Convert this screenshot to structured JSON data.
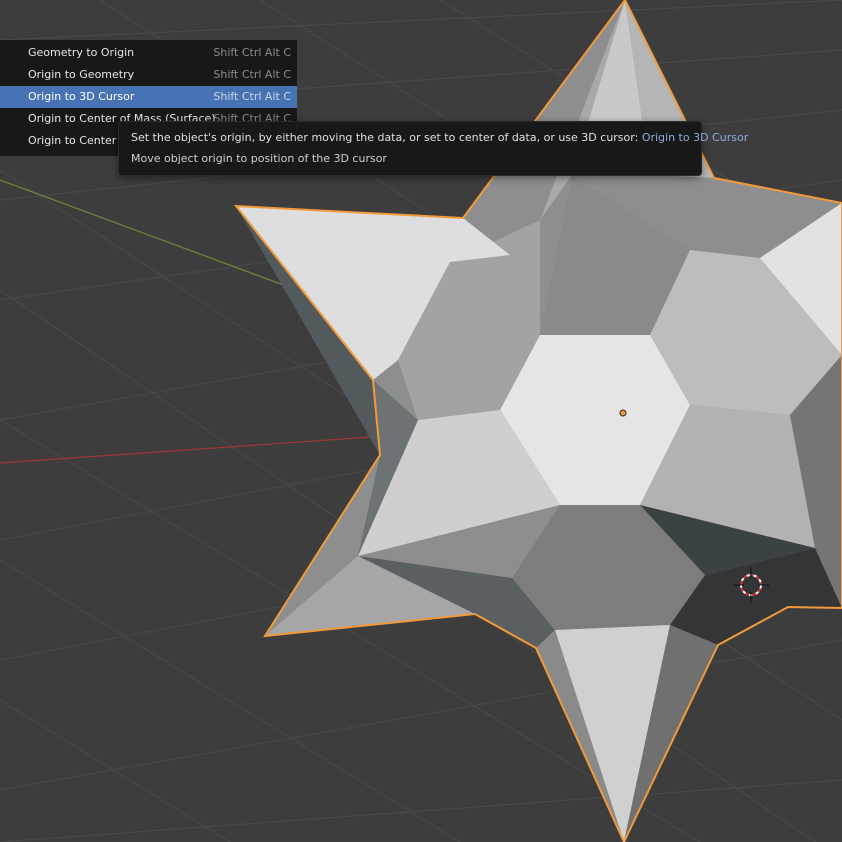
{
  "menu": {
    "items": [
      {
        "label": "Geometry to Origin",
        "shortcut": "Shift Ctrl Alt C"
      },
      {
        "label": "Origin to Geometry",
        "shortcut": "Shift Ctrl Alt C"
      },
      {
        "label": "Origin to 3D Cursor",
        "shortcut": "Shift Ctrl Alt C",
        "active": true
      },
      {
        "label": "Origin to Center of Mass (Surface)",
        "shortcut": "Shift Ctrl Alt C"
      },
      {
        "label": "Origin to Center of",
        "shortcut": ""
      }
    ]
  },
  "tooltip": {
    "description": "Set the object's origin, by either moving the data, or set to center of data, or use 3D cursor:",
    "operator": "Origin to 3D Cursor",
    "detail": "Move object origin to position of the 3D cursor"
  },
  "colors": {
    "background": "#3d3d3d",
    "menu_bg": "#181818",
    "highlight": "#4772b3",
    "selection_outline": "#f29a3a",
    "x_axis": "#a0373a",
    "y_axis": "#6a8a3a"
  },
  "icons": {
    "cursor": "3d-cursor-icon",
    "origin": "object-origin-icon"
  }
}
